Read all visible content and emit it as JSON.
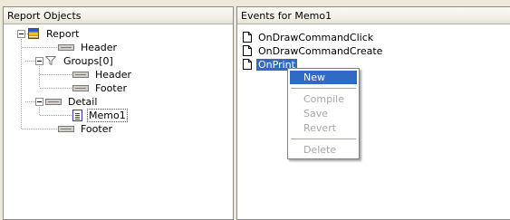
{
  "left_panel": {
    "header": "Report Objects",
    "tree": {
      "report": "Report",
      "header": "Header",
      "groups": "Groups[0]",
      "group_header": "Header",
      "group_footer": "Footer",
      "detail": "Detail",
      "memo": "Memo1",
      "footer": "Footer"
    }
  },
  "right_panel": {
    "header": "Events for Memo1",
    "events": [
      "OnDrawCommandClick",
      "OnDrawCommandCreate",
      "OnPrint"
    ]
  },
  "context_menu": {
    "items": {
      "new": "New",
      "compile": "Compile",
      "save": "Save",
      "revert": "Revert",
      "delete": "Delete"
    }
  }
}
